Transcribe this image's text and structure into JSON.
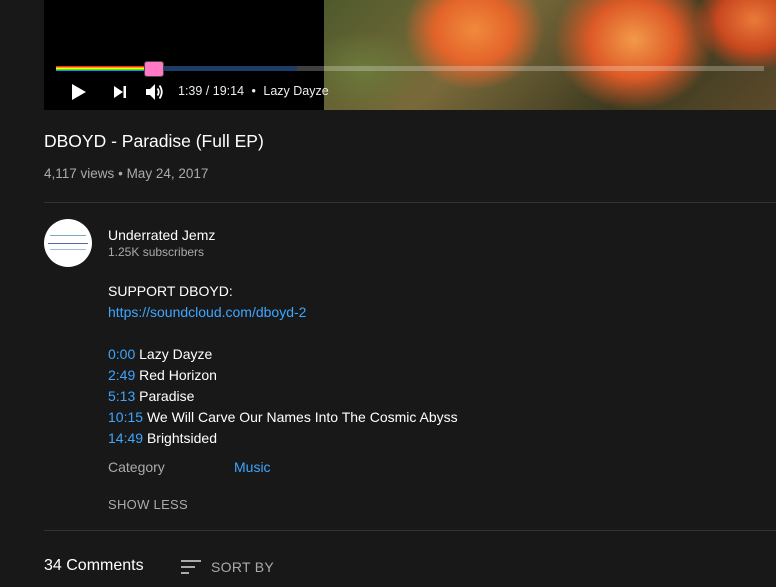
{
  "player": {
    "time_display": "1:39 / 19:14",
    "chapter_separator": "•",
    "chapter": "Lazy Dayze",
    "played_fraction": 0.136,
    "buffered_fraction": 0.34,
    "icons": {
      "play": "play-icon",
      "next": "skip-next-icon",
      "volume": "volume-icon"
    }
  },
  "video": {
    "title": "DBOYD - Paradise (Full EP)",
    "views": "4,117 views",
    "date": "May 24, 2017",
    "meta_separator": "•"
  },
  "channel": {
    "name": "Underrated Jemz",
    "subscribers": "1.25K subscribers"
  },
  "description": {
    "support_text": "SUPPORT DBOYD:",
    "link": "https://soundcloud.com/dboyd-2",
    "tracks": [
      {
        "time": "0:00",
        "title": "Lazy Dayze"
      },
      {
        "time": "2:49",
        "title": "Red Horizon"
      },
      {
        "time": "5:13",
        "title": "Paradise"
      },
      {
        "time": "10:15",
        "title": "We Will Carve Our Names Into The Cosmic Abyss"
      },
      {
        "time": "14:49",
        "title": "Brightsided"
      }
    ],
    "category_label": "Category",
    "category_value": "Music",
    "show_less": "SHOW LESS"
  },
  "comments": {
    "count_label": "34 Comments",
    "sort_label": "SORT BY",
    "sort_icon": "sort-icon"
  },
  "colors": {
    "background": "#181818",
    "link": "#3ea6ff",
    "secondary_text": "#aaaaaa",
    "scrubber": "#ff79c6"
  }
}
